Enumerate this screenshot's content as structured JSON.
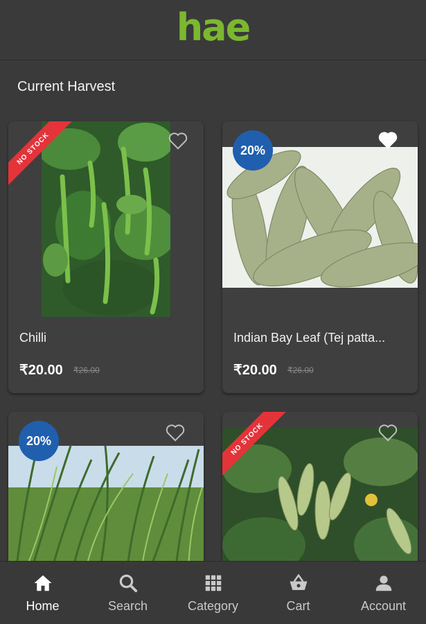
{
  "header": {
    "logo_text": "hae",
    "logo_color": "#7cb82f"
  },
  "section": {
    "title": "Current Harvest"
  },
  "products": [
    {
      "name": "Chilli",
      "price": "₹20.00",
      "old_price": "₹26.00",
      "ribbon": "NO STOCK",
      "badge": "",
      "favorited": false
    },
    {
      "name": "Indian Bay Leaf (Tej patta...",
      "price": "₹20.00",
      "old_price": "₹26.00",
      "ribbon": "",
      "badge": "20%",
      "favorited": true
    },
    {
      "name": "",
      "price": "",
      "old_price": "",
      "ribbon": "",
      "badge": "20%",
      "favorited": false
    },
    {
      "name": "",
      "price": "",
      "old_price": "",
      "ribbon": "NO STOCK",
      "badge": "",
      "favorited": false
    }
  ],
  "nav": {
    "items": [
      {
        "label": "Home",
        "icon": "home-icon",
        "active": true
      },
      {
        "label": "Search",
        "icon": "search-icon",
        "active": false
      },
      {
        "label": "Category",
        "icon": "grid-icon",
        "active": false
      },
      {
        "label": "Cart",
        "icon": "basket-icon",
        "active": false
      },
      {
        "label": "Account",
        "icon": "person-icon",
        "active": false
      }
    ]
  },
  "colors": {
    "background": "#3b3a3b",
    "card": "#403f40",
    "badge": "#1f5fae",
    "ribbon": "#e4343a"
  }
}
